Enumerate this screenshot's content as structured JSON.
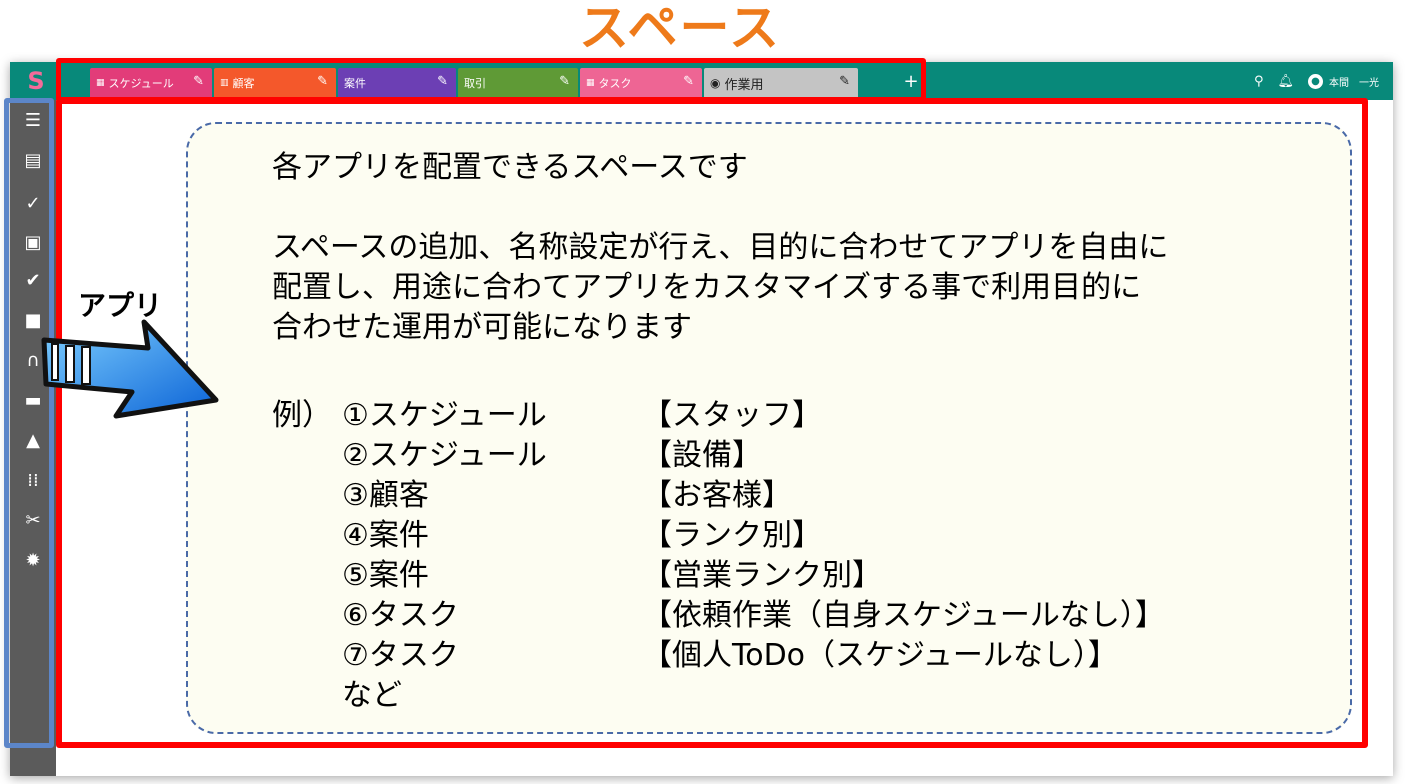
{
  "banner": {
    "title": "スペース"
  },
  "tabs": [
    {
      "icon": "▦",
      "label": "スケジュール",
      "color": "#e23c79"
    },
    {
      "icon": "▥",
      "label": "顧客",
      "color": "#f4582b"
    },
    {
      "icon": "",
      "label": "案件",
      "color": "#6c3fb4"
    },
    {
      "icon": "",
      "label": "取引",
      "color": "#5f9a36"
    },
    {
      "icon": "▦",
      "label": "タスク",
      "color": "#ee6594"
    },
    {
      "icon": "◉",
      "label": "作業用",
      "color": "#c4c4c4"
    }
  ],
  "toolbar": {
    "add_tab": "+"
  },
  "header": {
    "user_name": "本間　一光"
  },
  "sidebar_icons": [
    "menu-icon",
    "calendar-icon",
    "check-circle-icon",
    "contact-card-icon",
    "document-check-icon",
    "briefcase-icon",
    "headset-icon",
    "chat-icon",
    "bell-icon",
    "apps-grid-icon",
    "wrench-icon",
    "gear-icon"
  ],
  "annotation": {
    "app_label": "アプリ"
  },
  "note": {
    "line1": "各アプリを配置できるスペースです",
    "line2": "スペースの追加、名称設定が行え、目的に合わせてアプリを自由に",
    "line3": "配置し、用途に合わてアプリをカスタマイズする事で利用目的に",
    "line4": "合わせた運用が可能になります",
    "example_lead": "例）",
    "examples": [
      {
        "name": "①スケジュール",
        "desc": "【スタッフ】"
      },
      {
        "name": "②スケジュール",
        "desc": "【設備】"
      },
      {
        "name": "③顧客",
        "desc": "【お客様】"
      },
      {
        "name": "④案件",
        "desc": "【ランク別】"
      },
      {
        "name": "⑤案件",
        "desc": "【営業ランク別】"
      },
      {
        "name": "⑥タスク",
        "desc": "【依頼作業（自身スケジュールなし）】"
      },
      {
        "name": "⑦タスク",
        "desc": "【個人ToDo（スケジュールなし）】"
      }
    ],
    "tail": "など"
  }
}
